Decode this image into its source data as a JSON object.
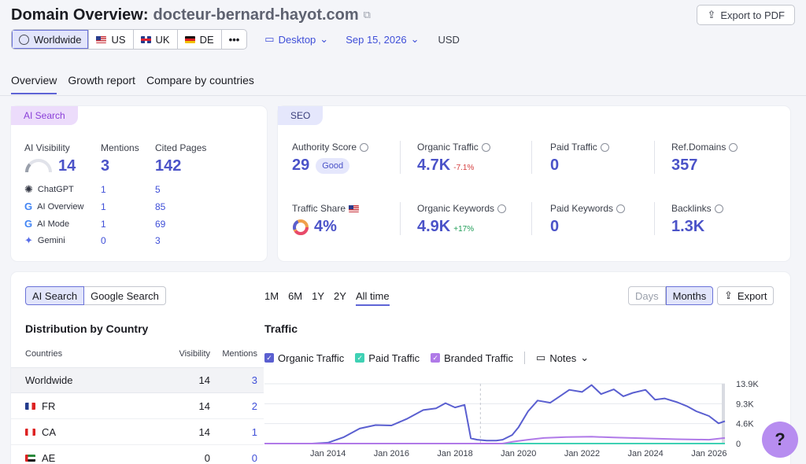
{
  "header": {
    "title": "Domain Overview:",
    "domain": "docteur-bernard-hayot.com",
    "export_pdf": "Export to PDF"
  },
  "filters": {
    "regions": [
      "Worldwide",
      "US",
      "UK",
      "DE",
      "•••"
    ],
    "device": "Desktop",
    "date": "Sep 15, 2026",
    "currency": "USD"
  },
  "tabs": [
    "Overview",
    "Growth report",
    "Compare by countries"
  ],
  "ai_card": {
    "pill": "AI Search",
    "cols": [
      "AI Visibility",
      "Mentions",
      "Cited Pages"
    ],
    "values": [
      "14",
      "3",
      "142"
    ],
    "engines": [
      {
        "name": "ChatGPT",
        "mentions": "1",
        "pages": "5"
      },
      {
        "name": "AI Overview",
        "mentions": "1",
        "pages": "85"
      },
      {
        "name": "AI Mode",
        "mentions": "1",
        "pages": "69"
      },
      {
        "name": "Gemini",
        "mentions": "0",
        "pages": "3"
      }
    ]
  },
  "seo_card": {
    "pill": "SEO",
    "metrics": [
      {
        "label": "Authority Score",
        "value": "29",
        "badge": "Good"
      },
      {
        "label": "Organic Traffic",
        "value": "4.7K",
        "delta": "-7.1%"
      },
      {
        "label": "Paid Traffic",
        "value": "0"
      },
      {
        "label": "Ref.Domains",
        "value": "357"
      },
      {
        "label": "Traffic Share",
        "value": "4%"
      },
      {
        "label": "Organic Keywords",
        "value": "4.9K",
        "delta": "+17%"
      },
      {
        "label": "Paid Keywords",
        "value": "0"
      },
      {
        "label": "Backlinks",
        "value": "1.3K"
      }
    ]
  },
  "lower": {
    "toggle": [
      "AI Search",
      "Google Search"
    ],
    "dist_title": "Distribution by Country",
    "table_headers": [
      "Countries",
      "Visibility",
      "Mentions"
    ],
    "rows": [
      {
        "country": "Worldwide",
        "visibility": "14",
        "mentions": "3"
      },
      {
        "country": "FR",
        "visibility": "14",
        "mentions": "2"
      },
      {
        "country": "CA",
        "visibility": "14",
        "mentions": "1"
      },
      {
        "country": "AE",
        "visibility": "0",
        "mentions": "0"
      }
    ],
    "ranges": [
      "1M",
      "6M",
      "1Y",
      "2Y",
      "All time"
    ],
    "granularity": [
      "Days",
      "Months"
    ],
    "export": "Export",
    "traffic_title": "Traffic",
    "legend": [
      "Organic Traffic",
      "Paid Traffic",
      "Branded Traffic"
    ],
    "notes": "Notes",
    "help": "?"
  },
  "chart_data": {
    "type": "line",
    "title": "Traffic",
    "x_ticks": [
      "Jan 2014",
      "Jan 2016",
      "Jan 2018",
      "Jan 2020",
      "Jan 2022",
      "Jan 2024",
      "Jan 2026"
    ],
    "y_ticks": [
      "13.9K",
      "9.3K",
      "4.6K",
      "0"
    ],
    "ylim": [
      0,
      13900
    ],
    "series": [
      {
        "name": "Organic Traffic",
        "color": "#5a5fd0",
        "x": [
          2012.0,
          2013.5,
          2014.0,
          2014.5,
          2015.0,
          2015.5,
          2016.0,
          2016.5,
          2017.0,
          2017.4,
          2017.7,
          2018.0,
          2018.3,
          2018.5,
          2018.7,
          2019.0,
          2019.3,
          2019.5,
          2019.8,
          2020.0,
          2020.3,
          2020.6,
          2021.0,
          2021.3,
          2021.6,
          2022.0,
          2022.3,
          2022.6,
          2023.0,
          2023.3,
          2023.6,
          2024.0,
          2024.3,
          2024.6,
          2025.0,
          2025.3,
          2025.6,
          2026.0,
          2026.3,
          2026.5
        ],
        "y": [
          0,
          0,
          200,
          1500,
          3500,
          4300,
          4200,
          5800,
          7800,
          8200,
          9400,
          8400,
          9000,
          1200,
          900,
          700,
          700,
          900,
          2000,
          3800,
          7500,
          10000,
          9500,
          11000,
          12500,
          12000,
          13600,
          11500,
          12600,
          11000,
          11800,
          12500,
          10200,
          10500,
          9600,
          8700,
          7500,
          6400,
          4700,
          5200
        ]
      },
      {
        "name": "Paid Traffic",
        "color": "#3fd1b4",
        "x": [
          2012.0,
          2026.5
        ],
        "y": [
          0,
          0
        ]
      },
      {
        "name": "Branded Traffic",
        "color": "#b07ae8",
        "x": [
          2012.0,
          2019.5,
          2019.8,
          2020.3,
          2020.8,
          2021.5,
          2022.3,
          2023.0,
          2024.0,
          2025.0,
          2026.0,
          2026.5
        ],
        "y": [
          0,
          0,
          400,
          900,
          1300,
          1500,
          1600,
          1400,
          1200,
          1000,
          900,
          1300
        ]
      }
    ]
  }
}
